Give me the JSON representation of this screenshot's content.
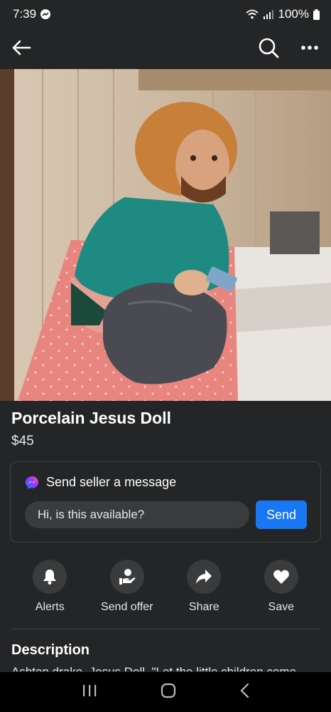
{
  "status": {
    "time": "7:39",
    "battery": "100%"
  },
  "icons": {
    "back": "arrow-left-icon",
    "search": "search-icon",
    "more": "more-dots-icon",
    "messenger": "messenger-icon",
    "alerts": "bell-icon",
    "send_offer": "offer-icon",
    "share": "share-arrow-icon",
    "save": "heart-icon"
  },
  "listing": {
    "title": "Porcelain Jesus Doll",
    "price": "$45"
  },
  "message": {
    "header": "Send seller a message",
    "input_value": "Hi, is this available?",
    "send_label": "Send"
  },
  "actions": [
    {
      "label": "Alerts"
    },
    {
      "label": "Send offer"
    },
    {
      "label": "Share"
    },
    {
      "label": "Save"
    }
  ],
  "description": {
    "heading": "Description",
    "text": "Ashton drake, Jesus Doll. \"Let the little children come"
  },
  "colors": {
    "background": "#242526",
    "accent": "#1877f2",
    "surface": "#3a3b3c"
  }
}
